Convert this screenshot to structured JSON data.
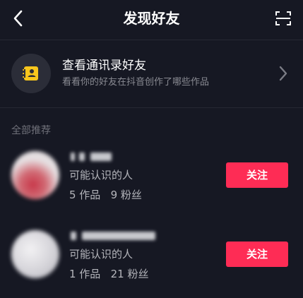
{
  "header": {
    "title": "发现好友",
    "back_icon": "chevron-left-icon",
    "scan_icon": "scan-icon"
  },
  "contacts": {
    "title": "查看通讯录好友",
    "subtitle": "看看你的好友在抖音创作了哪些作品",
    "icon": "contact-book-icon",
    "accent_color": "#f8c61c"
  },
  "section": {
    "label": "全部推荐"
  },
  "users": [
    {
      "relation": "可能认识的人",
      "stats": "5 作品   9 粉丝",
      "follow_label": "关注"
    },
    {
      "relation": "可能认识的人",
      "stats": "1 作品   21 粉丝",
      "follow_label": "关注"
    }
  ],
  "colors": {
    "background": "#161823",
    "follow_button": "#fe2c55",
    "secondary_text": "#8a8b93"
  }
}
